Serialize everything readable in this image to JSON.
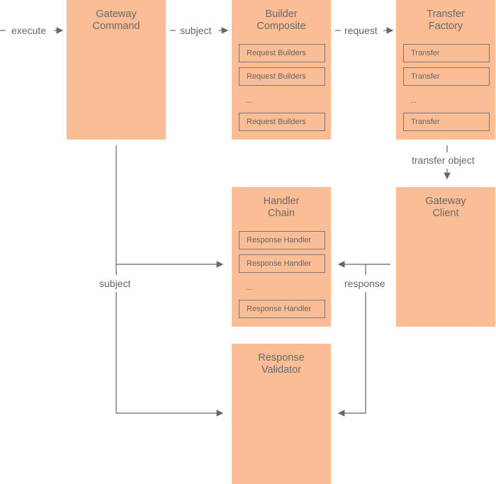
{
  "colors": {
    "box": "#fabd95",
    "line": "#666666"
  },
  "boxes": {
    "gateway_command": {
      "title": [
        "Gateway",
        "Command"
      ]
    },
    "builder_composite": {
      "title": [
        "Builder",
        "Composite"
      ],
      "items": [
        "Request Builders",
        "Request Builders",
        "...",
        "Request Builders"
      ]
    },
    "transfer_factory": {
      "title": [
        "Transfer",
        "Factory"
      ],
      "items": [
        "Transfer",
        "Transfer",
        "...",
        "Transfer"
      ]
    },
    "handler_chain": {
      "title": [
        "Handler",
        "Chain"
      ],
      "items": [
        "Response Handler",
        "Response Handler",
        "...",
        "Response Handler"
      ]
    },
    "gateway_client": {
      "title": [
        "Gateway",
        "Client"
      ]
    },
    "response_validator": {
      "title": [
        "Response",
        "Validator"
      ]
    }
  },
  "edges": {
    "execute": "execute",
    "subject_top": "subject",
    "request": "request",
    "transfer_object": "transfer object",
    "subject_left": "subject",
    "response": "response"
  }
}
